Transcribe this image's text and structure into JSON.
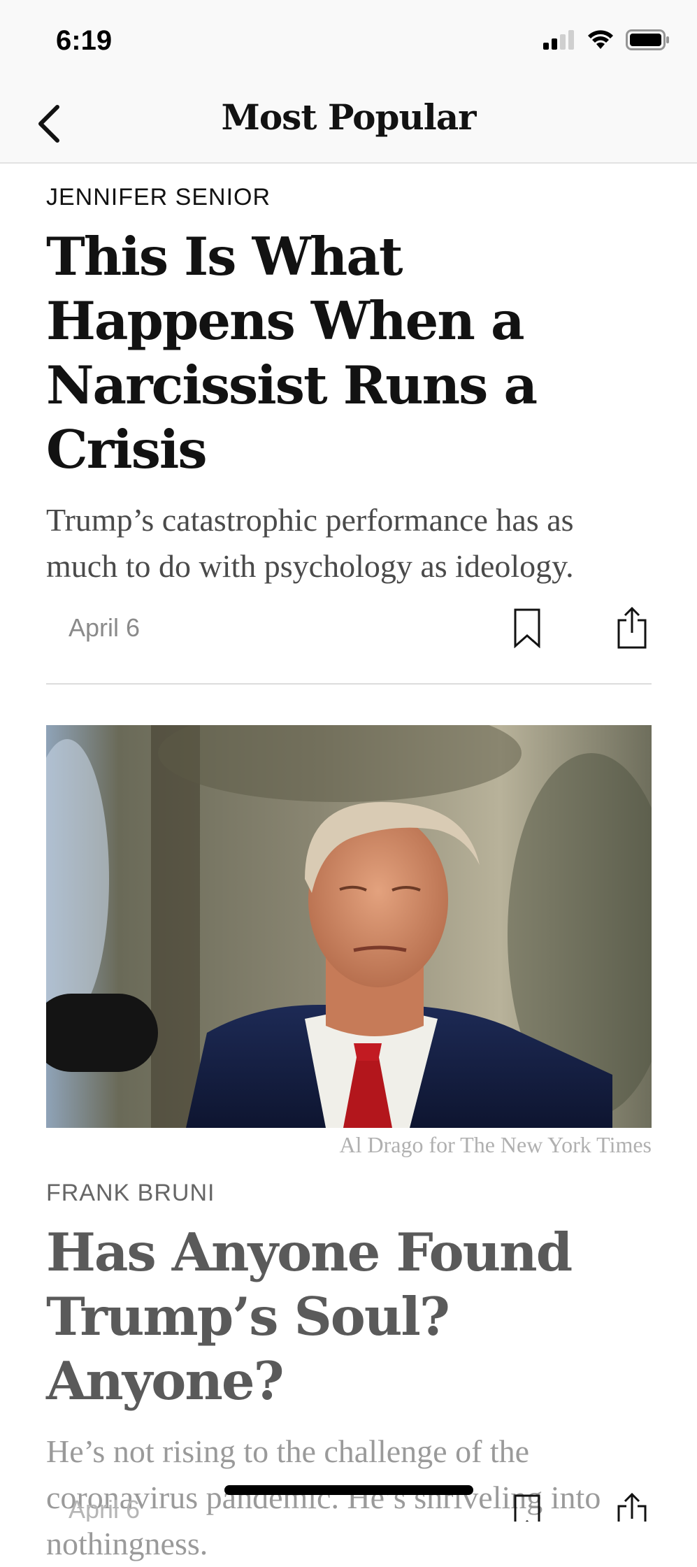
{
  "status_bar": {
    "time": "6:19"
  },
  "nav": {
    "title": "Most Popular"
  },
  "articles": [
    {
      "author": "JENNIFER SENIOR",
      "headline": "This Is What Happens When a Narcissist Runs a Crisis",
      "summary": "Trump’s catastrophic performance has as much to do with psychology as ideology.",
      "date": "April 6"
    },
    {
      "photo_credit": "Al Drago for The New York Times",
      "author": "FRANK BRUNI",
      "headline": "Has Anyone Found Trump’s Soul? Anyone?",
      "summary": "He’s not rising to the challenge of the coronavirus pandemic. He’s shriveling into nothingness.",
      "date": "April 6"
    }
  ],
  "icons": {
    "back": "chevron-left-icon",
    "bookmark": "bookmark-icon",
    "share": "share-icon",
    "signal": "cellular-signal-icon",
    "wifi": "wifi-icon",
    "battery": "battery-icon"
  }
}
